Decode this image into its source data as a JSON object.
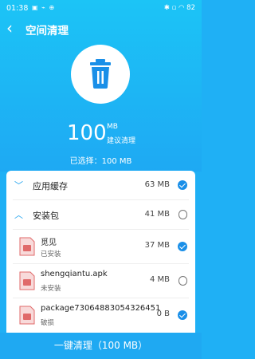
{
  "status_bar": {
    "time": "01:38",
    "left_icons": "▣ ⌁ ⊕",
    "right_icons": "✱ ▫ ◠ 82"
  },
  "header": {
    "title": "空间清理"
  },
  "summary": {
    "size": "100",
    "unit": "MB",
    "hint": "建议清理",
    "selected": "已选择：100 MB"
  },
  "categories": [
    {
      "label": "应用缓存",
      "amount": "63 MB",
      "checked": true,
      "expanded": false
    },
    {
      "label": "安装包",
      "amount": "41 MB",
      "checked": false,
      "expanded": true
    }
  ],
  "packages": [
    {
      "name": "觅见",
      "state": "已安装",
      "amount": "37 MB",
      "checked": true
    },
    {
      "name": "shengqiantu.apk",
      "state": "未安装",
      "amount": "4 MB",
      "checked": false
    },
    {
      "name": "package730648830543264515...",
      "state": "破损",
      "amount": "0 B",
      "checked": true
    }
  ],
  "action": {
    "label": "一键清理（100 MB）"
  },
  "colors": {
    "accent": "#1a8fe8",
    "hero_top": "#1cc4f6",
    "hero_bottom": "#1ea9f3",
    "apk_icon": "#e06a6a"
  }
}
